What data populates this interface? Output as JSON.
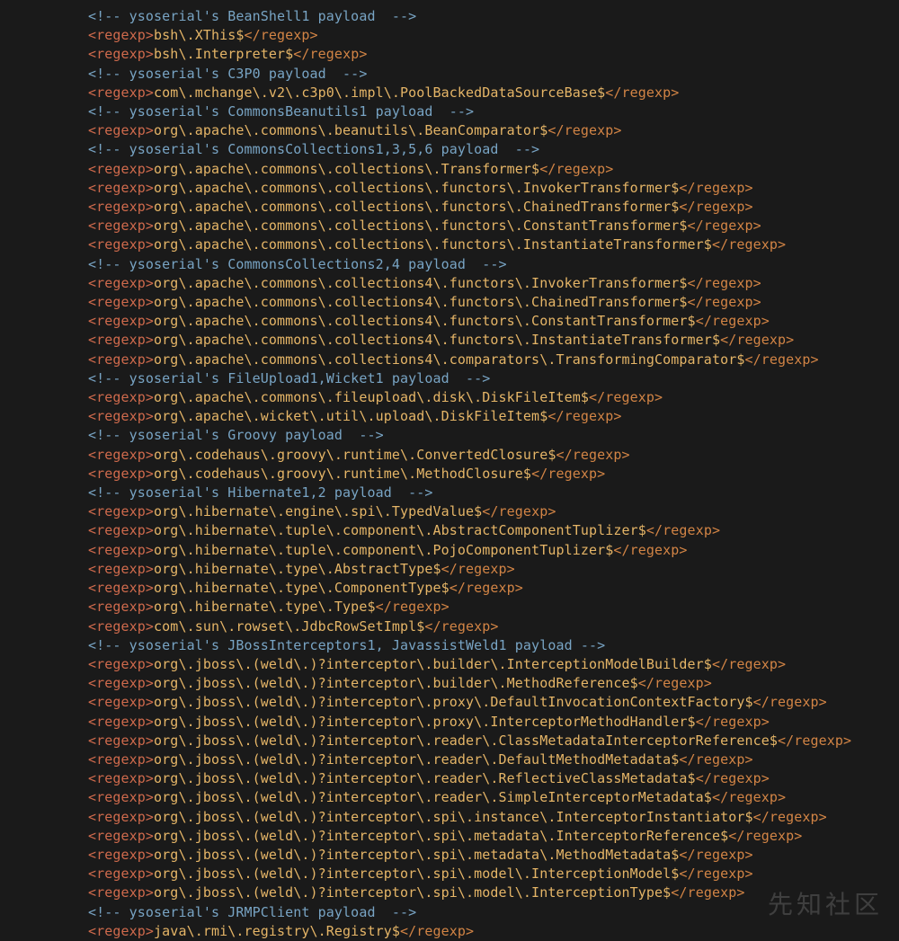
{
  "lines": [
    {
      "t": "c",
      "v": "<!-- ysoserial's BeanShell1 payload  -->"
    },
    {
      "t": "r",
      "v": "bsh\\.XThis$"
    },
    {
      "t": "r",
      "v": "bsh\\.Interpreter$"
    },
    {
      "t": "c",
      "v": "<!-- ysoserial's C3P0 payload  -->"
    },
    {
      "t": "r",
      "v": "com\\.mchange\\.v2\\.c3p0\\.impl\\.PoolBackedDataSourceBase$"
    },
    {
      "t": "c",
      "v": "<!-- ysoserial's CommonsBeanutils1 payload  -->"
    },
    {
      "t": "r",
      "v": "org\\.apache\\.commons\\.beanutils\\.BeanComparator$"
    },
    {
      "t": "c",
      "v": "<!-- ysoserial's CommonsCollections1,3,5,6 payload  -->"
    },
    {
      "t": "r",
      "v": "org\\.apache\\.commons\\.collections\\.Transformer$"
    },
    {
      "t": "r",
      "v": "org\\.apache\\.commons\\.collections\\.functors\\.InvokerTransformer$"
    },
    {
      "t": "r",
      "v": "org\\.apache\\.commons\\.collections\\.functors\\.ChainedTransformer$"
    },
    {
      "t": "r",
      "v": "org\\.apache\\.commons\\.collections\\.functors\\.ConstantTransformer$"
    },
    {
      "t": "r",
      "v": "org\\.apache\\.commons\\.collections\\.functors\\.InstantiateTransformer$"
    },
    {
      "t": "c",
      "v": "<!-- ysoserial's CommonsCollections2,4 payload  -->"
    },
    {
      "t": "r",
      "v": "org\\.apache\\.commons\\.collections4\\.functors\\.InvokerTransformer$"
    },
    {
      "t": "r",
      "v": "org\\.apache\\.commons\\.collections4\\.functors\\.ChainedTransformer$"
    },
    {
      "t": "r",
      "v": "org\\.apache\\.commons\\.collections4\\.functors\\.ConstantTransformer$"
    },
    {
      "t": "r",
      "v": "org\\.apache\\.commons\\.collections4\\.functors\\.InstantiateTransformer$"
    },
    {
      "t": "r",
      "v": "org\\.apache\\.commons\\.collections4\\.comparators\\.TransformingComparator$"
    },
    {
      "t": "c",
      "v": "<!-- ysoserial's FileUpload1,Wicket1 payload  -->"
    },
    {
      "t": "r",
      "v": "org\\.apache\\.commons\\.fileupload\\.disk\\.DiskFileItem$"
    },
    {
      "t": "r",
      "v": "org\\.apache\\.wicket\\.util\\.upload\\.DiskFileItem$"
    },
    {
      "t": "c",
      "v": "<!-- ysoserial's Groovy payload  -->"
    },
    {
      "t": "r",
      "v": "org\\.codehaus\\.groovy\\.runtime\\.ConvertedClosure$"
    },
    {
      "t": "r",
      "v": "org\\.codehaus\\.groovy\\.runtime\\.MethodClosure$"
    },
    {
      "t": "c",
      "v": "<!-- ysoserial's Hibernate1,2 payload  -->"
    },
    {
      "t": "r",
      "v": "org\\.hibernate\\.engine\\.spi\\.TypedValue$"
    },
    {
      "t": "r",
      "v": "org\\.hibernate\\.tuple\\.component\\.AbstractComponentTuplizer$"
    },
    {
      "t": "r",
      "v": "org\\.hibernate\\.tuple\\.component\\.PojoComponentTuplizer$"
    },
    {
      "t": "r",
      "v": "org\\.hibernate\\.type\\.AbstractType$"
    },
    {
      "t": "r",
      "v": "org\\.hibernate\\.type\\.ComponentType$"
    },
    {
      "t": "r",
      "v": "org\\.hibernate\\.type\\.Type$"
    },
    {
      "t": "r",
      "v": "com\\.sun\\.rowset\\.JdbcRowSetImpl$"
    },
    {
      "t": "c",
      "v": "<!-- ysoserial's JBossInterceptors1, JavassistWeld1 payload -->"
    },
    {
      "t": "r",
      "v": "org\\.jboss\\.(weld\\.)?interceptor\\.builder\\.InterceptionModelBuilder$"
    },
    {
      "t": "r",
      "v": "org\\.jboss\\.(weld\\.)?interceptor\\.builder\\.MethodReference$"
    },
    {
      "t": "r",
      "v": "org\\.jboss\\.(weld\\.)?interceptor\\.proxy\\.DefaultInvocationContextFactory$"
    },
    {
      "t": "r",
      "v": "org\\.jboss\\.(weld\\.)?interceptor\\.proxy\\.InterceptorMethodHandler$"
    },
    {
      "t": "r",
      "v": "org\\.jboss\\.(weld\\.)?interceptor\\.reader\\.ClassMetadataInterceptorReference$"
    },
    {
      "t": "r",
      "v": "org\\.jboss\\.(weld\\.)?interceptor\\.reader\\.DefaultMethodMetadata$"
    },
    {
      "t": "r",
      "v": "org\\.jboss\\.(weld\\.)?interceptor\\.reader\\.ReflectiveClassMetadata$"
    },
    {
      "t": "r",
      "v": "org\\.jboss\\.(weld\\.)?interceptor\\.reader\\.SimpleInterceptorMetadata$"
    },
    {
      "t": "r",
      "v": "org\\.jboss\\.(weld\\.)?interceptor\\.spi\\.instance\\.InterceptorInstantiator$"
    },
    {
      "t": "r",
      "v": "org\\.jboss\\.(weld\\.)?interceptor\\.spi\\.metadata\\.InterceptorReference$"
    },
    {
      "t": "r",
      "v": "org\\.jboss\\.(weld\\.)?interceptor\\.spi\\.metadata\\.MethodMetadata$"
    },
    {
      "t": "r",
      "v": "org\\.jboss\\.(weld\\.)?interceptor\\.spi\\.model\\.InterceptionModel$"
    },
    {
      "t": "r",
      "v": "org\\.jboss\\.(weld\\.)?interceptor\\.spi\\.model\\.InterceptionType$"
    },
    {
      "t": "c",
      "v": "<!-- ysoserial's JRMPClient payload  -->"
    },
    {
      "t": "r",
      "v": "java\\.rmi\\.registry\\.Registry$"
    }
  ],
  "open_tag": "<regexp>",
  "close_tag": "</regexp>",
  "watermark": "先知社区"
}
